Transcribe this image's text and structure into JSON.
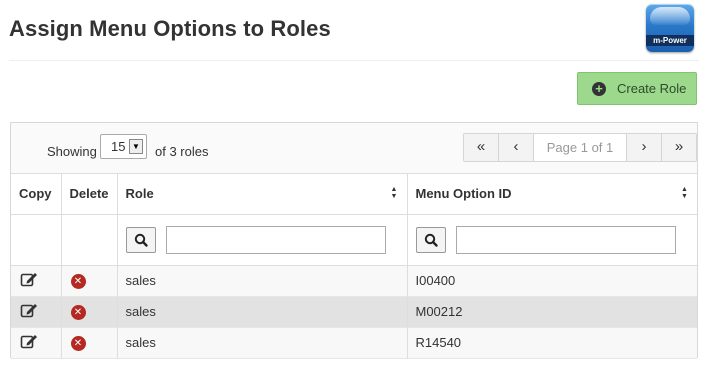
{
  "page": {
    "title": "Assign Menu Options to Roles"
  },
  "logo": {
    "text": "m-Power"
  },
  "toolbar": {
    "create_role_label": "Create Role",
    "create_icon": "plus-circle-icon"
  },
  "list": {
    "showing_label": "Showing",
    "page_size": "15",
    "of_roles": "of 3 roles"
  },
  "pagination": {
    "first": "«",
    "prev": "‹",
    "info": "Page 1 of 1",
    "next": "›",
    "last": "»"
  },
  "table": {
    "columns": {
      "copy": "Copy",
      "delete": "Delete",
      "role": "Role",
      "menu_option": "Menu Option ID"
    },
    "rows": [
      {
        "role": "sales",
        "menu_option_id": "I00400"
      },
      {
        "role": "sales",
        "menu_option_id": "M00212"
      },
      {
        "role": "sales",
        "menu_option_id": "R14540"
      }
    ]
  },
  "colors": {
    "create_button": "#9cd98c",
    "delete_icon": "#b42a22",
    "alt_row": "#e2e2e2"
  }
}
